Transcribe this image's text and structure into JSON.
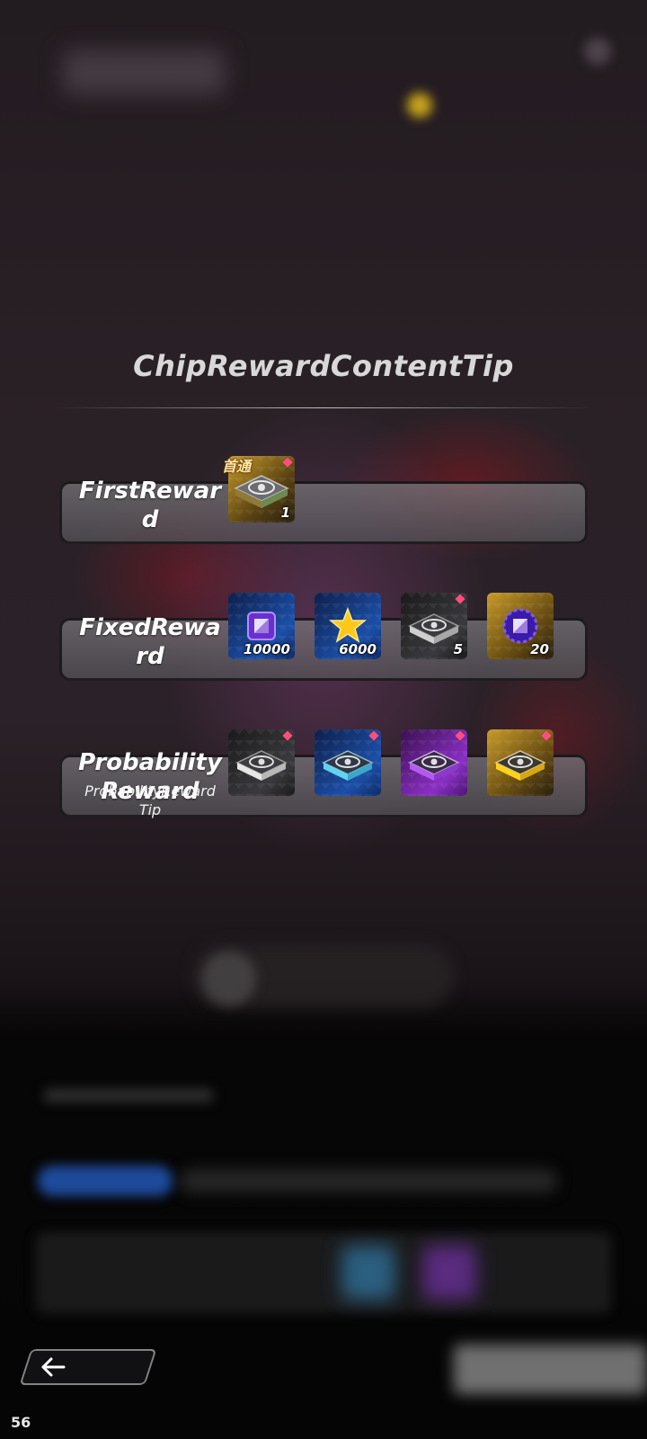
{
  "dialog": {
    "title": "ChipRewardContentTip"
  },
  "rows": [
    {
      "label": "FirstReward",
      "label_lines": [
        "FirstRewar",
        "d"
      ],
      "badge": "首通",
      "items": [
        {
          "icon": "chip-gold-icon",
          "count": "1"
        }
      ]
    },
    {
      "label": "FixedReward",
      "label_lines": [
        "FixedRewa",
        "rd"
      ],
      "items": [
        {
          "icon": "purple-cube-icon",
          "count": "10000"
        },
        {
          "icon": "gold-star-icon",
          "count": "6000"
        },
        {
          "icon": "chip-grey-icon",
          "count": "5"
        },
        {
          "icon": "purple-core-icon",
          "count": "20"
        }
      ]
    },
    {
      "label": "ProbabilityReward",
      "label_lines": [
        "Probability",
        "Reward"
      ],
      "sublabel_lines": [
        "ProbabilityReward",
        "Tip"
      ],
      "items": [
        {
          "icon": "chip-white-icon",
          "count": ""
        },
        {
          "icon": "chip-cyan-icon",
          "count": ""
        },
        {
          "icon": "chip-purple-icon",
          "count": ""
        },
        {
          "icon": "chip-yellow-icon",
          "count": ""
        }
      ]
    }
  ],
  "footer": {
    "back_icon": "back-arrow-icon",
    "fps": "56"
  },
  "colors": {
    "rarity_gold": "#c89b2a",
    "rarity_blue": "#1c4fa8",
    "rarity_purple": "#8a2fc4",
    "rarity_dark": "#2a2a2c",
    "pip": "#ff4d7d"
  }
}
